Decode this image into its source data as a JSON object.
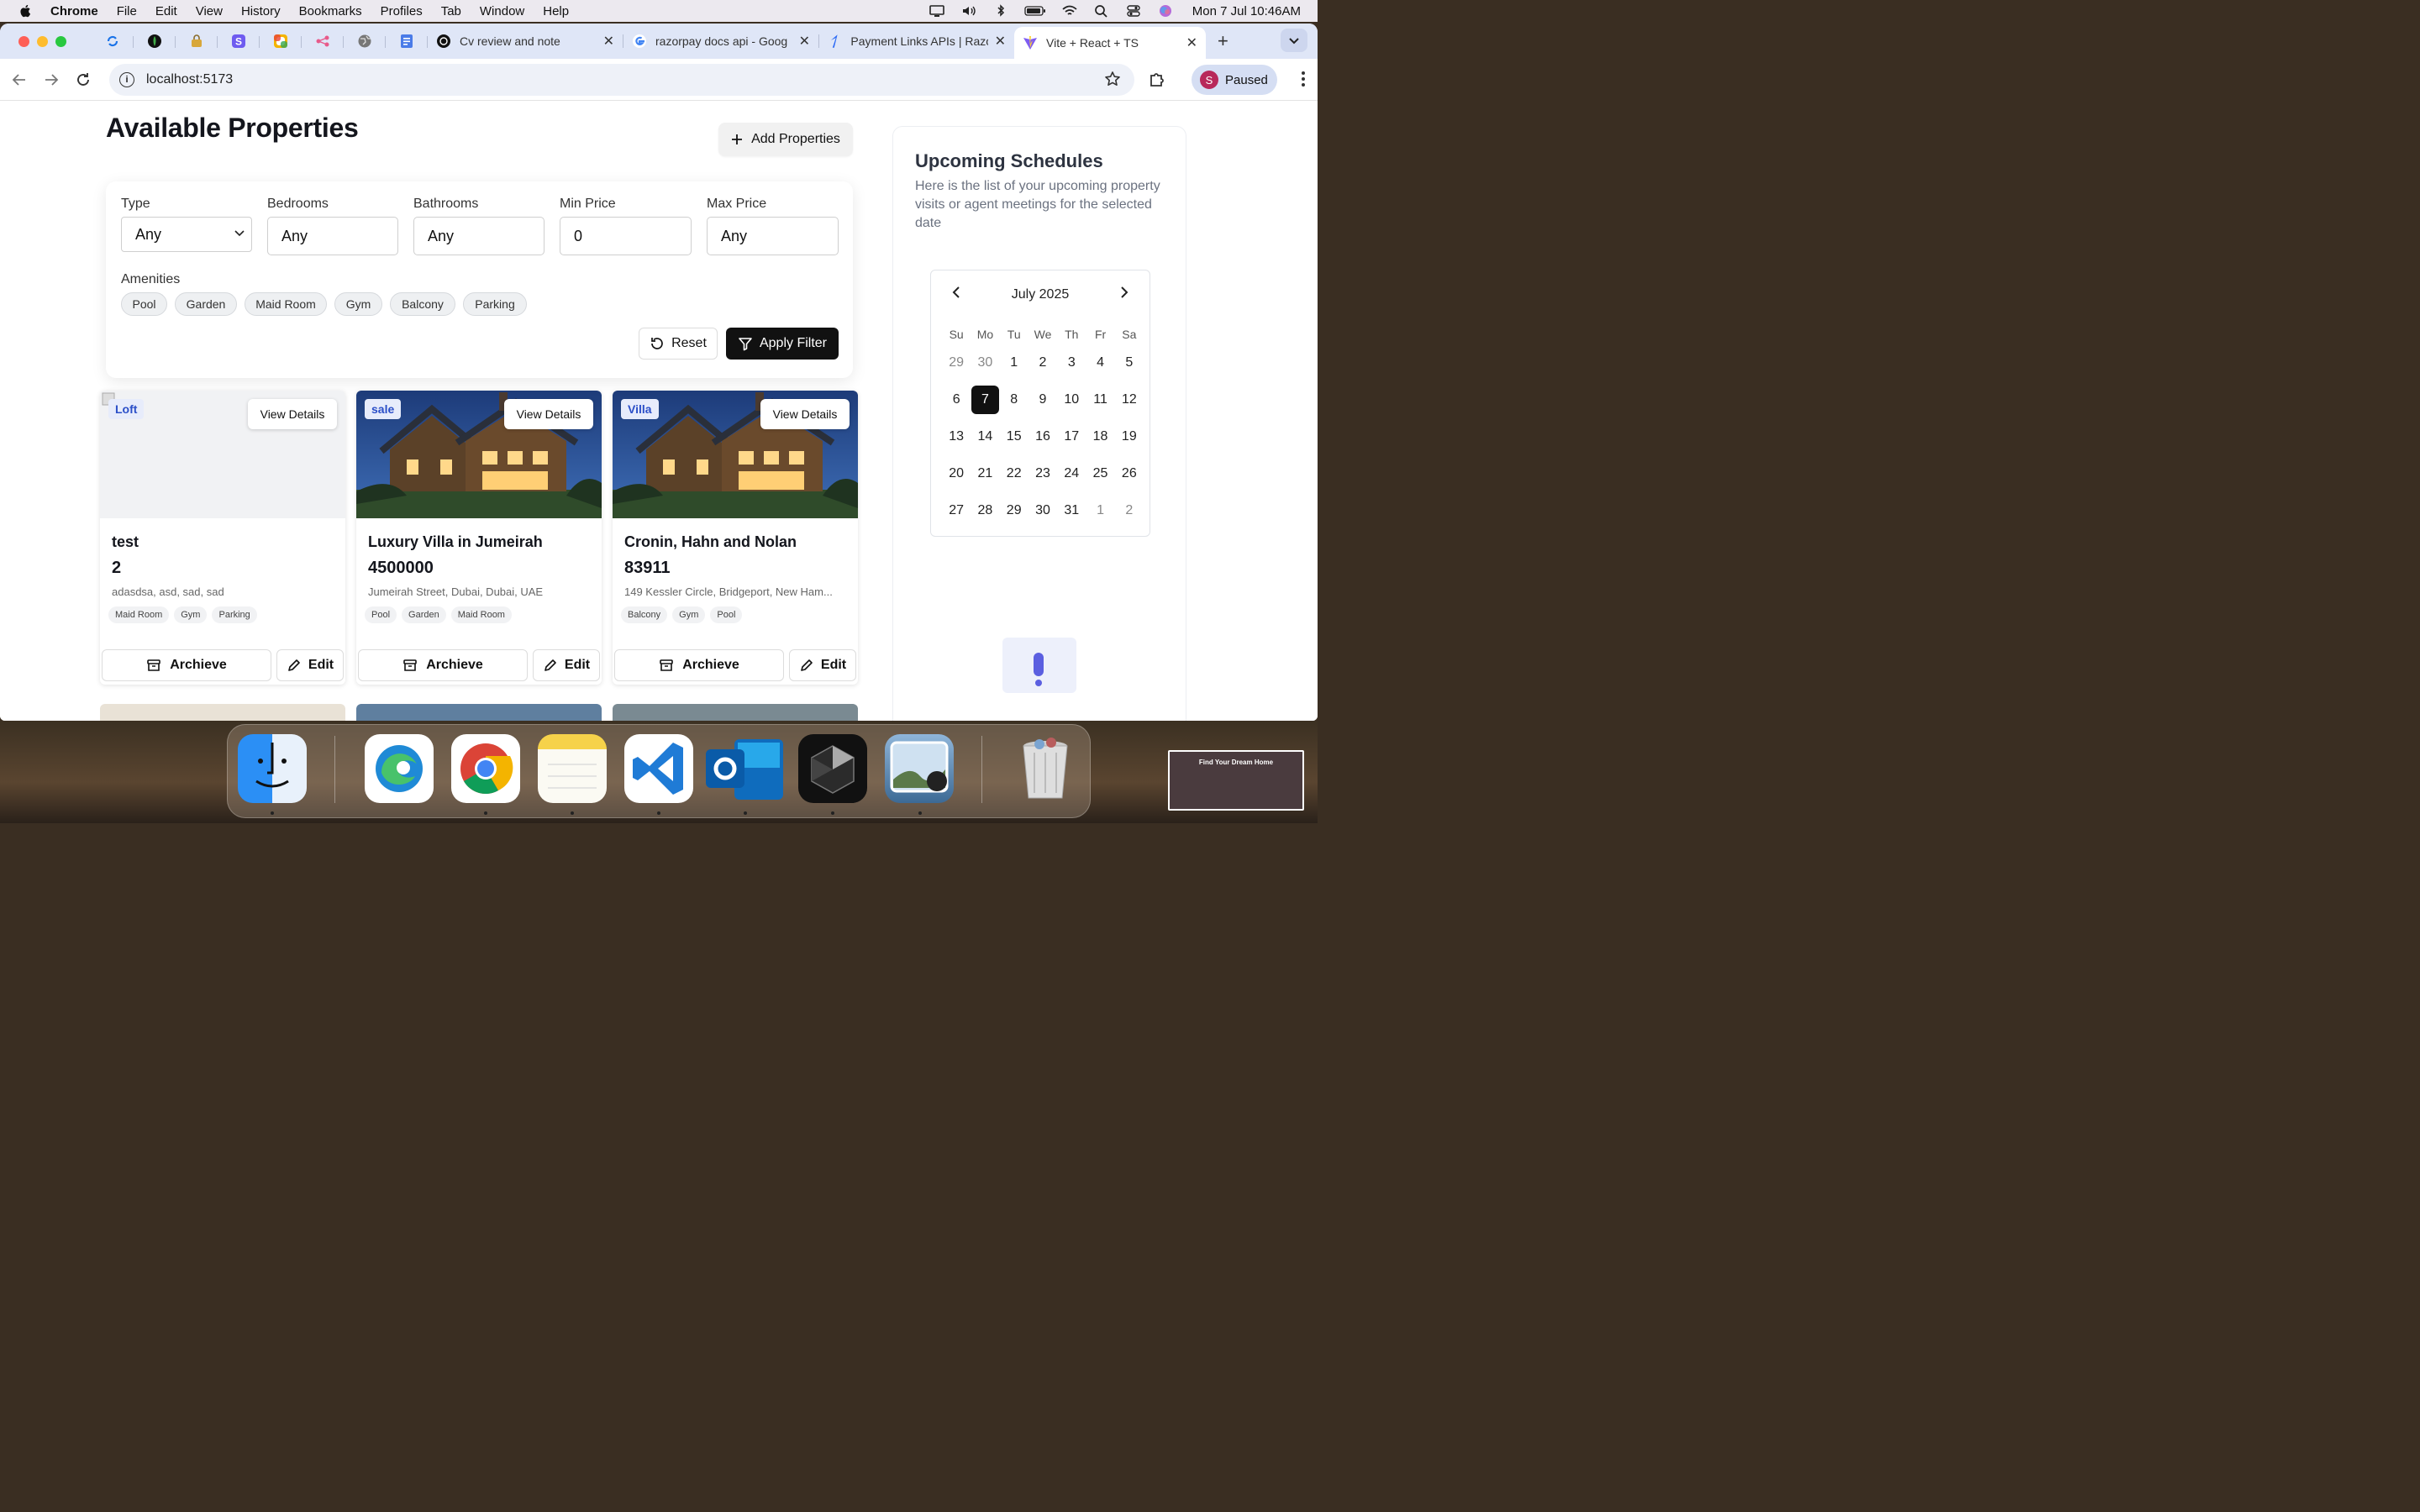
{
  "menubar": {
    "app": "Chrome",
    "items": [
      "File",
      "Edit",
      "View",
      "History",
      "Bookmarks",
      "Profiles",
      "Tab",
      "Window",
      "Help"
    ],
    "clock": "Mon 7 Jul  10:46AM"
  },
  "tabs": [
    {
      "title": "Cv review and note",
      "icon": "openai-icon"
    },
    {
      "title": "razorpay docs api - Goog",
      "icon": "google-icon"
    },
    {
      "title": "Payment Links APIs | Razo",
      "icon": "razorpay-icon"
    },
    {
      "title": "Vite + React + TS",
      "icon": "vite-icon",
      "active": true
    }
  ],
  "toolbar": {
    "url": "localhost:5173",
    "profile_initial": "S",
    "profile_label": "Paused"
  },
  "page": {
    "title": "Available Properties",
    "add_button": "Add Properties",
    "filters": {
      "type_label": "Type",
      "type_value": "Any",
      "bedrooms_label": "Bedrooms",
      "bedrooms_value": "Any",
      "bathrooms_label": "Bathrooms",
      "bathrooms_value": "Any",
      "min_price_label": "Min Price",
      "min_price_value": "0",
      "max_price_label": "Max Price",
      "max_price_value": "Any",
      "amenities_label": "Amenities",
      "amenities": [
        "Pool",
        "Garden",
        "Maid Room",
        "Gym",
        "Balcony",
        "Parking"
      ],
      "reset": "Reset",
      "apply": "Apply Filter"
    },
    "cards": [
      {
        "tag": "Loft",
        "view": "View Details",
        "title": "test",
        "price": "2",
        "address": "adasdsa, asd, sad, sad",
        "amenities": [
          "Maid Room",
          "Gym",
          "Parking"
        ],
        "archive": "Archieve",
        "edit": "Edit",
        "has_image": false
      },
      {
        "tag": "sale",
        "view": "View Details",
        "title": "Luxury Villa in Jumeirah",
        "price": "4500000",
        "address": "Jumeirah Street, Dubai, Dubai, UAE",
        "amenities": [
          "Pool",
          "Garden",
          "Maid Room"
        ],
        "archive": "Archieve",
        "edit": "Edit",
        "has_image": true
      },
      {
        "tag": "Villa",
        "view": "View Details",
        "title": "Cronin, Hahn and Nolan",
        "price": "83911",
        "address": "149 Kessler Circle, Bridgeport, New Ham...",
        "amenities": [
          "Balcony",
          "Gym",
          "Pool"
        ],
        "archive": "Archieve",
        "edit": "Edit",
        "has_image": true
      }
    ]
  },
  "schedules": {
    "title": "Upcoming Schedules",
    "description": "Here is the list of your upcoming property visits or agent meetings for the selected date",
    "calendar": {
      "month": "July 2025",
      "weekdays": [
        "Su",
        "Mo",
        "Tu",
        "We",
        "Th",
        "Fr",
        "Sa"
      ],
      "weeks": [
        [
          "29",
          "30",
          "1",
          "2",
          "3",
          "4",
          "5"
        ],
        [
          "6",
          "7",
          "8",
          "9",
          "10",
          "11",
          "12"
        ],
        [
          "13",
          "14",
          "15",
          "16",
          "17",
          "18",
          "19"
        ],
        [
          "20",
          "21",
          "22",
          "23",
          "24",
          "25",
          "26"
        ],
        [
          "27",
          "28",
          "29",
          "30",
          "31",
          "1",
          "2"
        ]
      ],
      "selected": "7"
    }
  },
  "thumbnail": {
    "title": "Find Your Dream Home"
  },
  "dock": [
    "finder",
    "edge",
    "chrome",
    "notes",
    "vscode",
    "outlook",
    "cursor",
    "preview",
    "trash"
  ]
}
